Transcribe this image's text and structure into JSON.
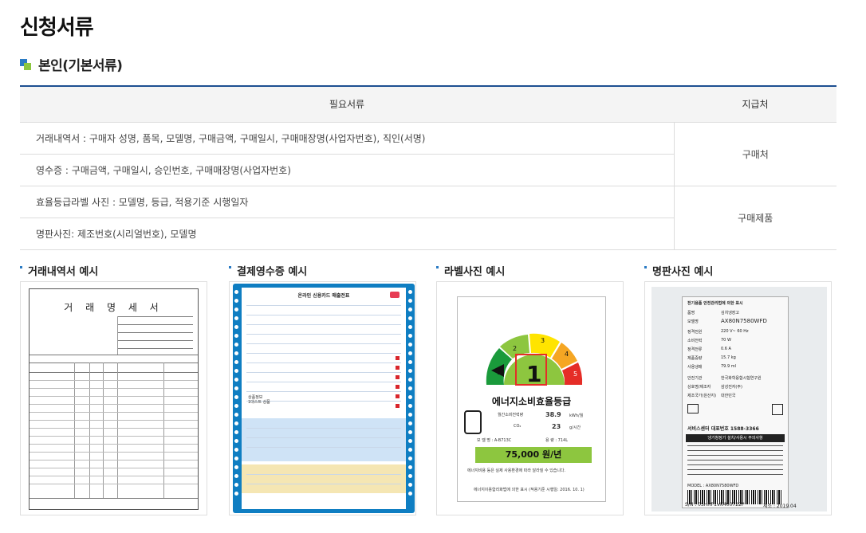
{
  "page": {
    "title": "신청서류"
  },
  "section": {
    "title": "본인(기본서류)"
  },
  "table": {
    "headers": [
      "필요서류",
      "지급처"
    ],
    "rows": [
      {
        "doc": "거래내역서 : 구매자 성명, 품목, 모델명, 구매금액, 구매일시, 구매매장명(사업자번호), 직인(서명)"
      },
      {
        "doc": "영수증 : 구매금액, 구매일시, 승인번호, 구매매장명(사업자번호)"
      },
      {
        "doc": "효율등급라벨 사진 : 모델명, 등급, 적용기준 시행일자"
      },
      {
        "doc": "명판사진: 제조번호(시리얼번호), 모델명"
      }
    ],
    "payees": [
      "구매처",
      "구매제품"
    ]
  },
  "examples": [
    {
      "label": "거래내역서 예시"
    },
    {
      "label": "결제영수증 예시"
    },
    {
      "label": "라벨사진 예시"
    },
    {
      "label": "명판사진 예시"
    }
  ],
  "invoice": {
    "title": "거 래 명 세 서"
  },
  "receipt": {
    "title": "온라인 신용카드 매출전표",
    "amount_label": "상품정보",
    "item": "1대스트 상품"
  },
  "energy_label": {
    "grade": "1",
    "grade_scale": [
      "1",
      "2",
      "3",
      "4",
      "5"
    ],
    "title": "에너지소비효율등급",
    "power_label": "월간소비전력량",
    "power_value": "38.9",
    "power_unit": "kWh/월",
    "co2_label": "CO₂",
    "co2_value": "23",
    "co2_unit": "g/시간",
    "model": "모 델 명 : A-B713C",
    "volume": "용 량 : 714L",
    "cost": "75,000 원/년",
    "note": "에너지비용 등은 실제 사용환경에 따라 달라질 수 있습니다.",
    "footer": "에너지이용합리화법에 의한 표시 (적용기준 시행일: 2016. 10. 1)",
    "colors": {
      "g1": "#1a9a3b",
      "g2": "#8dc63f",
      "g3": "#ffe400",
      "g4": "#f5a623",
      "g5": "#e52d27",
      "box": "#e52d27"
    }
  },
  "nameplate": {
    "title": "전기용품 안전관리법에 의한 표시",
    "rows": [
      {
        "k": "품명",
        "v": "김치냉장고"
      },
      {
        "k": "모델명",
        "v": "AX80N7580WFD"
      },
      {
        "k": "정격전원",
        "v": "220 V~ 60 Hz"
      },
      {
        "k": "소비전력",
        "v": "70 W"
      },
      {
        "k": "정격전류",
        "v": "0.6 A"
      },
      {
        "k": "제품중량",
        "v": "15.7 kg"
      },
      {
        "k": "사용냉매",
        "v": "79.9 ml"
      },
      {
        "k": "안전기관",
        "v": "한국화학융합시험연구원"
      },
      {
        "k": "상호명/제조자",
        "v": "삼성전자(주)"
      },
      {
        "k": "제조국가(원산지)",
        "v": "대한민국"
      }
    ],
    "service": "서비스센터 대표번호 1588-3366",
    "warning": "냉기청정기 설치/사용시 주의사항",
    "model_footer": "MODEL : AX80N7580WFD",
    "serial": "S/N : 0SHRP1VK400722P",
    "date": "제조 : 2019.04"
  }
}
